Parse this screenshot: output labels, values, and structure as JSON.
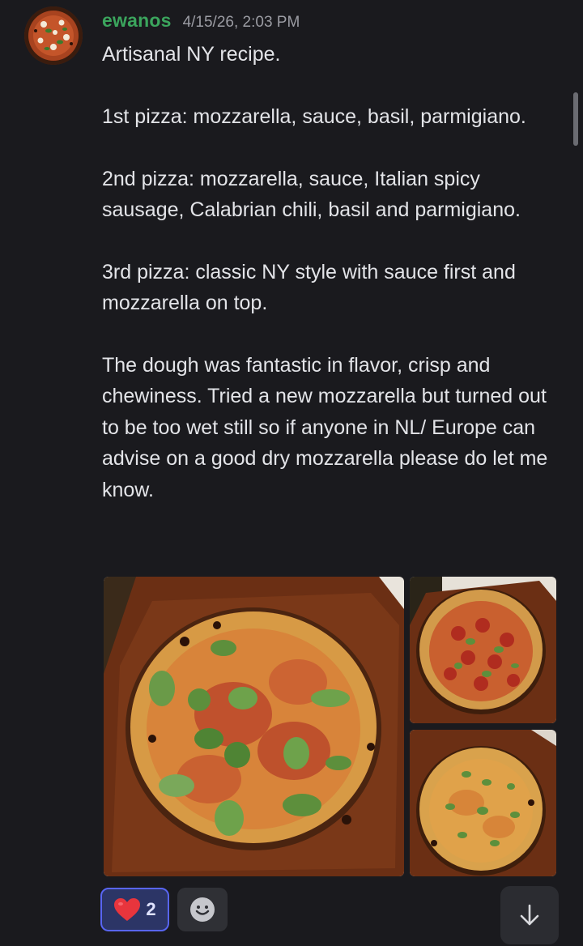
{
  "message": {
    "author": "ewanos",
    "timestamp": "4/15/26, 2:03 PM",
    "paragraphs": [
      "Artisanal NY recipe.",
      "1st pizza: mozzarella, sauce, basil, parmigiano.",
      "2nd pizza: mozzarella, sauce, Italian spicy sausage, Calabrian chili, basil and parmigiano.",
      "3rd pizza: classic NY style with sauce first and mozzarella on top.",
      "The dough was fantastic in flavor, crisp and chewiness. Tried a new mozzarella but turned out to be too wet still so if anyone in NL/ Europe can advise on a good dry mozzarella please do let me know."
    ]
  },
  "attachments": [
    {
      "icon": "pizza-photo-1"
    },
    {
      "icon": "pizza-photo-2"
    },
    {
      "icon": "pizza-photo-3"
    }
  ],
  "reactions": [
    {
      "emoji": "heart-icon",
      "count": "2",
      "selected": true
    }
  ],
  "icons": {
    "add_reaction": "smiley-icon",
    "scroll_down": "arrow-down-icon"
  },
  "colors": {
    "background": "#1a1a1e",
    "username": "#3ba55d",
    "timestamp": "#9b9ca3",
    "text": "#e3e4e8",
    "reaction_selected_bg": "#2c3566",
    "reaction_selected_border": "#5865f2",
    "heart": "#e8353d"
  }
}
